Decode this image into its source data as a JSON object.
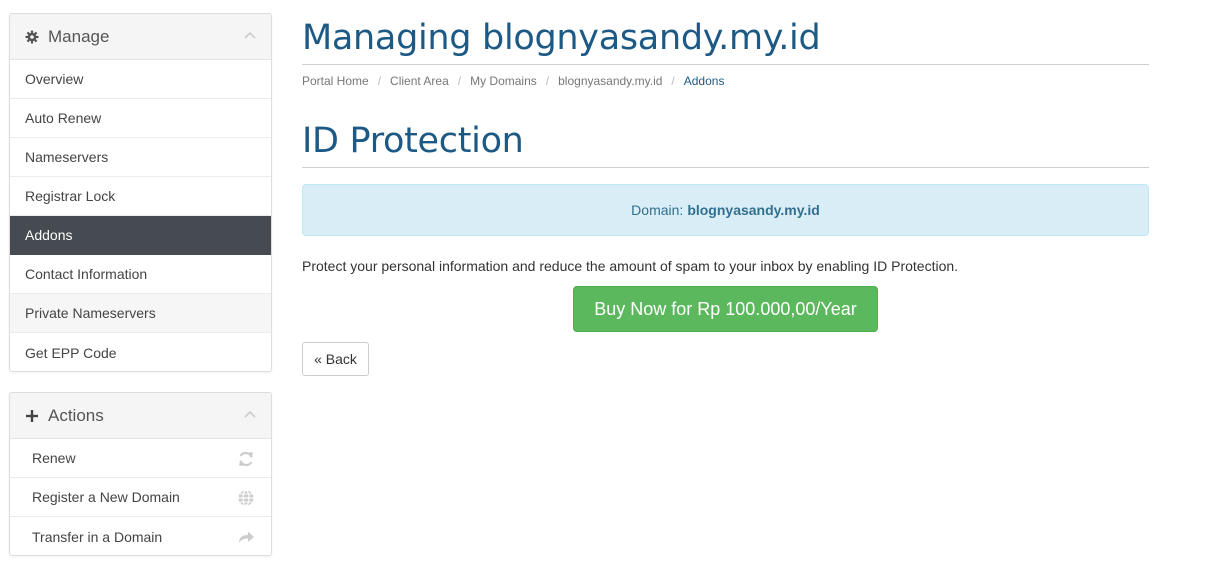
{
  "sidebar": {
    "manage": {
      "title": "Manage",
      "icon": "gear-icon",
      "items": [
        {
          "label": "Overview"
        },
        {
          "label": "Auto Renew"
        },
        {
          "label": "Nameservers"
        },
        {
          "label": "Registrar Lock"
        },
        {
          "label": "Addons",
          "active": true
        },
        {
          "label": "Contact Information"
        },
        {
          "label": "Private Nameservers"
        },
        {
          "label": "Get EPP Code"
        }
      ]
    },
    "actions": {
      "title": "Actions",
      "icon": "plus-icon",
      "items": [
        {
          "label": "Renew",
          "icon": "refresh-icon"
        },
        {
          "label": "Register a New Domain",
          "icon": "globe-icon"
        },
        {
          "label": "Transfer in a Domain",
          "icon": "share-arrow-icon"
        }
      ]
    }
  },
  "main": {
    "page_title": "Managing blognyasandy.my.id",
    "breadcrumb": [
      "Portal Home",
      "Client Area",
      "My Domains",
      "blognyasandy.my.id",
      "Addons"
    ],
    "section_title": "ID Protection",
    "alert": {
      "label": "Domain:",
      "domain": "blognyasandy.my.id"
    },
    "description": "Protect your personal information and reduce the amount of spam to your inbox by enabling ID Protection.",
    "buy_button": "Buy Now for Rp 100.000,00/Year",
    "back_button": "« Back"
  },
  "colors": {
    "title": "#1c5a85",
    "active_menu_bg": "#454b50",
    "alert_bg": "#d9edf7",
    "buy_button": "#5cb85c"
  }
}
